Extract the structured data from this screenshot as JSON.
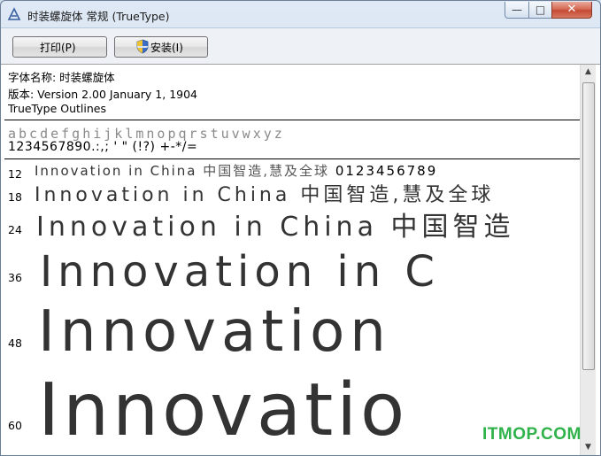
{
  "window": {
    "title": "时装螺旋体 常规 (TrueType)"
  },
  "titlebar_controls": {
    "minimize": "—",
    "maximize": "□",
    "close": "✕"
  },
  "toolbar": {
    "print_label": "打印(P)",
    "install_label": "安装(I)"
  },
  "font_info": {
    "name_line": "字体名称: 时装螺旋体",
    "version_line": "版本: Version 2.00 January 1, 1904",
    "outline_line": "TrueType Outlines"
  },
  "charset": {
    "letters": "abcdefghijklmnopqrstuvwxyz",
    "digits": "1234567890.:,; ' \" (!?) +-*/="
  },
  "samples": [
    {
      "size": "12",
      "text": "Innovation in China",
      "cn": "中国智造,慧及全球",
      "num": "0123456789"
    },
    {
      "size": "18",
      "text": "Innovation in China",
      "cn": "中国智造,慧及全球"
    },
    {
      "size": "24",
      "text": "Innovation in China",
      "cn": "中国智造"
    },
    {
      "size": "36",
      "text": "Innovation in C"
    },
    {
      "size": "48",
      "text": "Innovation"
    },
    {
      "size": "60",
      "text": "Innovatio"
    }
  ],
  "icons": {
    "app": "font-file-icon",
    "shield": "uac-shield-icon"
  },
  "watermark": "ITMOP.COM",
  "colors": {
    "accent_green": "#2fb24a",
    "close_red": "#c54a35"
  }
}
